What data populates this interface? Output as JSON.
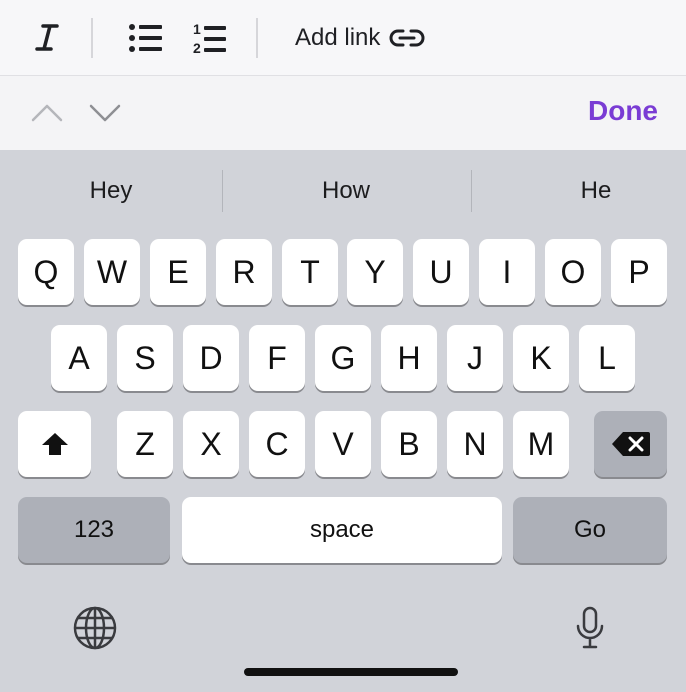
{
  "format_bar": {
    "italic_icon": "italic-icon",
    "bullet_list_icon": "bullet-list-icon",
    "numbered_list_icon": "numbered-list-icon",
    "numbered_list_digits": [
      "1",
      "2"
    ],
    "add_link_label": "Add link",
    "link_icon": "link-icon"
  },
  "nav_bar": {
    "prev_icon": "chevron-up-icon",
    "next_icon": "chevron-down-icon",
    "done_label": "Done",
    "accent_color": "#7a3cd4"
  },
  "suggestions": [
    "Hey",
    "How",
    "He"
  ],
  "keyboard": {
    "row1": [
      "Q",
      "W",
      "E",
      "R",
      "T",
      "Y",
      "U",
      "I",
      "O",
      "P"
    ],
    "row2": [
      "A",
      "S",
      "D",
      "F",
      "G",
      "H",
      "J",
      "K",
      "L"
    ],
    "row3": [
      "Z",
      "X",
      "C",
      "V",
      "B",
      "N",
      "M"
    ],
    "shift_icon": "shift-icon",
    "backspace_icon": "backspace-icon",
    "numbers_label": "123",
    "space_label": "space",
    "go_label": "Go",
    "globe_icon": "globe-icon",
    "mic_icon": "microphone-icon"
  }
}
